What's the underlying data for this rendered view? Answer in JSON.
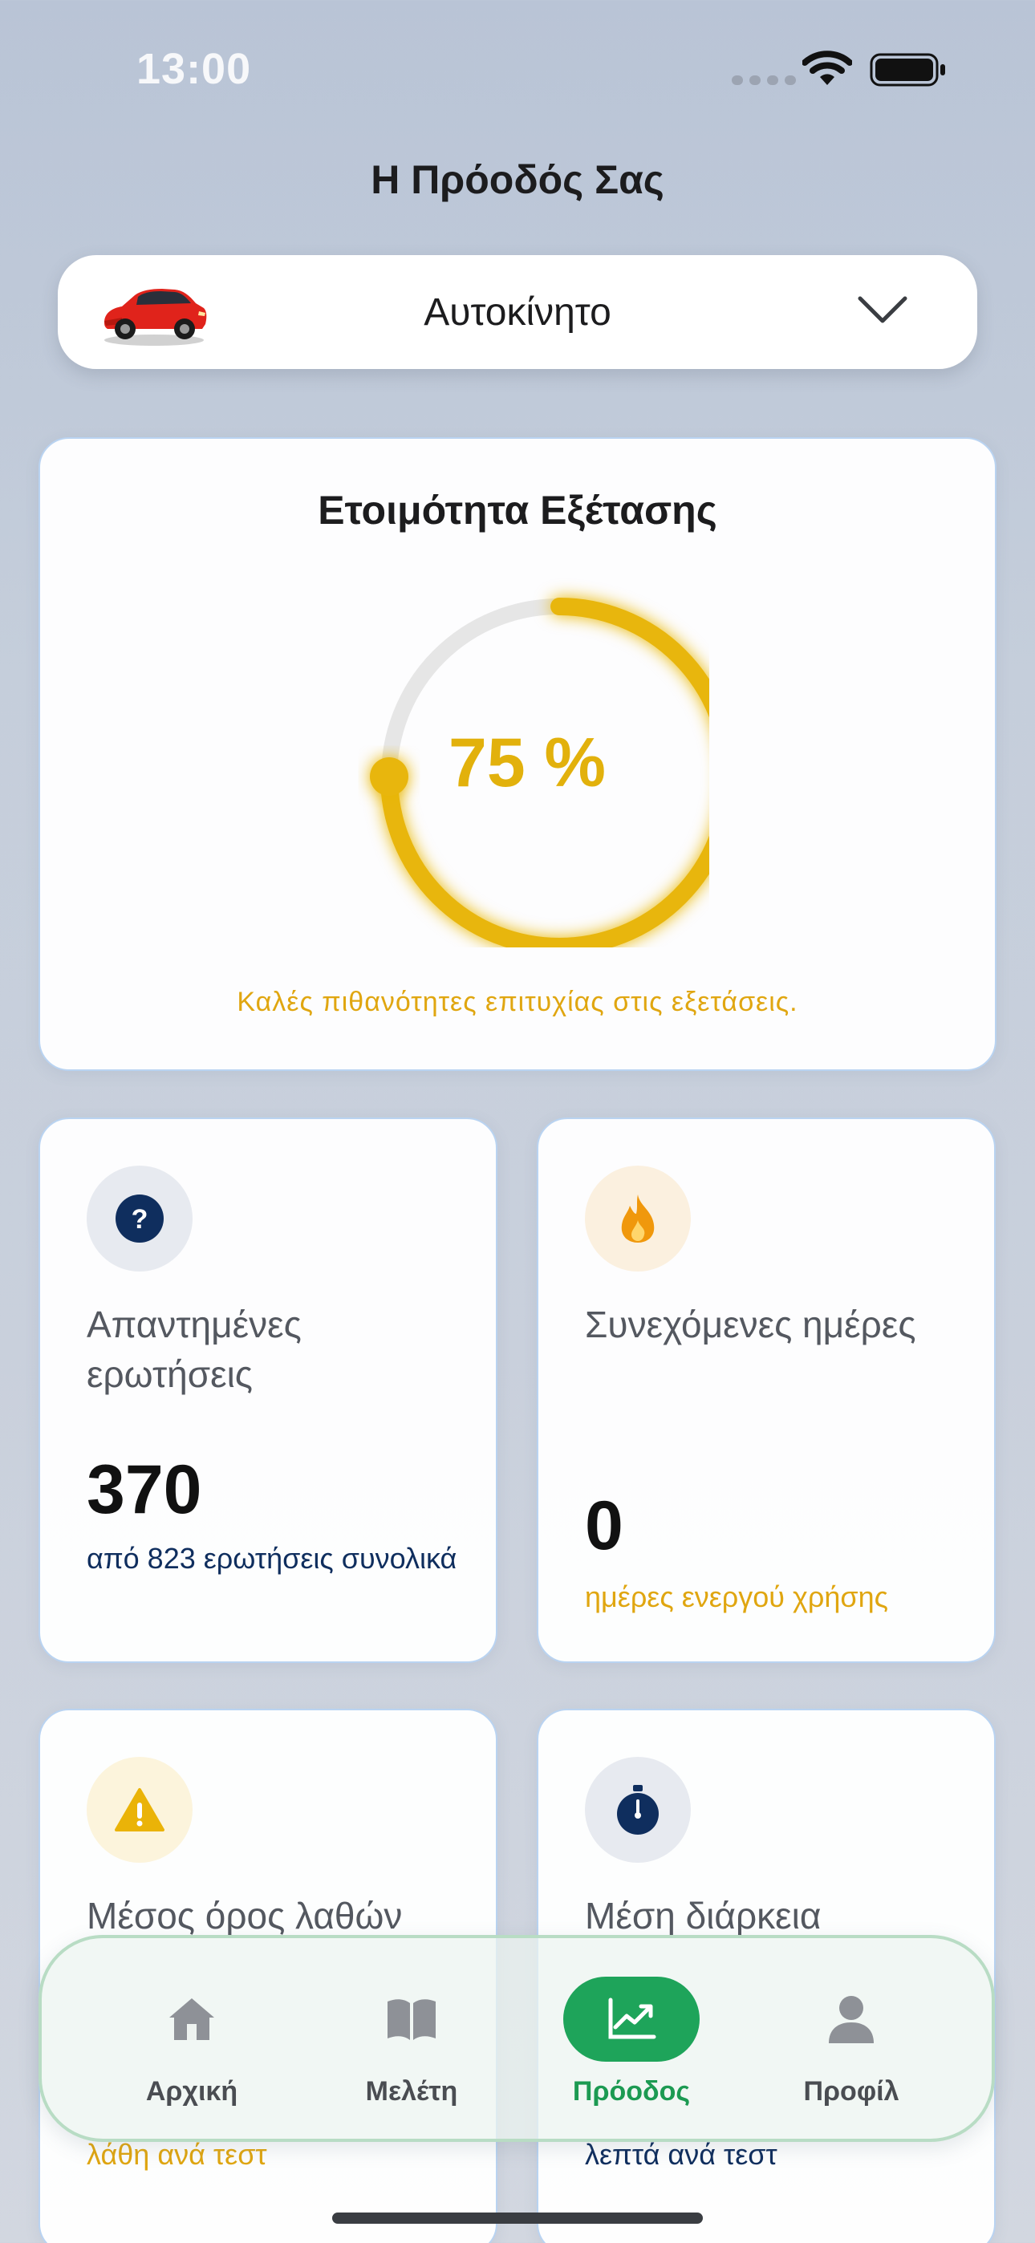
{
  "status_bar": {
    "time": "13:00"
  },
  "header": {
    "title": "Η Πρόοδός Σας"
  },
  "vehicle_selector": {
    "selected": "Αυτοκίνητο",
    "icon": "car-icon"
  },
  "readiness": {
    "title": "Ετοιμότητα Εξέτασης",
    "percent": 75,
    "value_text": "75 %",
    "message": "Καλές πιθανότητες επιτυχίας στις εξετάσεις.",
    "accent_color": "#e8b60f"
  },
  "stats": {
    "answered": {
      "icon": "question-icon",
      "label": "Απαντημένες ερωτήσεις",
      "value": "370",
      "sub": "από 823 ερωτήσεις συνολικά"
    },
    "streak": {
      "icon": "flame-icon",
      "label": "Συνεχόμενες ημέρες",
      "value": "0",
      "sub": "ημέρες ενεργού χρήσης"
    },
    "errors": {
      "icon": "warning-icon",
      "label": "Μέσος όρος λαθών",
      "sub": "λάθη ανά τεστ"
    },
    "duration": {
      "icon": "stopwatch-icon",
      "label": "Μέση διάρκεια",
      "sub": "λεπτά ανά τεστ"
    }
  },
  "tab_bar": {
    "tabs": [
      {
        "label": "Αρχική",
        "icon": "home-icon",
        "active": false
      },
      {
        "label": "Μελέτη",
        "icon": "book-icon",
        "active": false
      },
      {
        "label": "Πρόοδος",
        "icon": "chart-icon",
        "active": true
      },
      {
        "label": "Προφίλ",
        "icon": "person-icon",
        "active": false
      }
    ]
  },
  "colors": {
    "navy": "#0f2e5e",
    "gold": "#e2b10c",
    "green": "#1ea45a"
  }
}
